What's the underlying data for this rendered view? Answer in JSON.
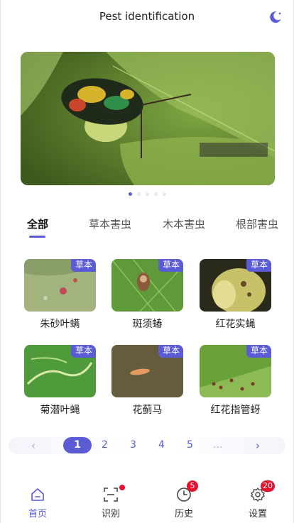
{
  "header": {
    "title": "Pest identification",
    "theme_icon": "moon-icon"
  },
  "banner": {
    "watermark": "",
    "slide_count": 5,
    "active_slide": 1
  },
  "tabs": [
    {
      "label": "全部",
      "active": true
    },
    {
      "label": "草本害虫",
      "active": false
    },
    {
      "label": "木本害虫",
      "active": false
    },
    {
      "label": "根部害虫",
      "active": false
    }
  ],
  "pests": [
    {
      "name": "朱砂叶螨",
      "badge": "草本"
    },
    {
      "name": "斑须蝽",
      "badge": "草本"
    },
    {
      "name": "红花实蝇",
      "badge": "草本"
    },
    {
      "name": "菊潜叶蝇",
      "badge": "草本"
    },
    {
      "name": "花蓟马",
      "badge": "草本"
    },
    {
      "name": "红花指管蚜",
      "badge": "草本"
    }
  ],
  "pagination": {
    "prev": "‹",
    "pages": [
      "1",
      "2",
      "3",
      "4",
      "5"
    ],
    "current": "1",
    "ellipsis": "...",
    "next": "›"
  },
  "tabbar": [
    {
      "label": "首页",
      "icon": "home-icon",
      "active": true
    },
    {
      "label": "识别",
      "icon": "scan-icon",
      "dot": true
    },
    {
      "label": "历史",
      "icon": "clock-icon",
      "badge": "5"
    },
    {
      "label": "设置",
      "icon": "gear-icon",
      "badge": "20"
    }
  ],
  "colors": {
    "accent": "#5b5bd6",
    "badge_red": "#e8112d"
  }
}
